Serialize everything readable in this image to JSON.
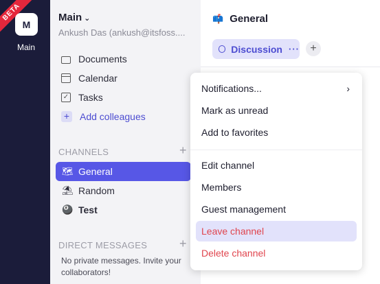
{
  "rail": {
    "badge": "BETA",
    "workspace_initial": "M",
    "workspace_label": "Main"
  },
  "sidebar": {
    "workspace_name": "Main",
    "workspace_user": "Ankush Das (ankush@itsfoss....",
    "nav": [
      {
        "label": "Documents",
        "icon": "folder-icon"
      },
      {
        "label": "Calendar",
        "icon": "calendar-icon"
      },
      {
        "label": "Tasks",
        "icon": "checkbox-icon"
      },
      {
        "label": "Add colleagues",
        "icon": "plus-icon"
      }
    ],
    "channels_header": "CHANNELS",
    "channels": [
      {
        "emoji": "🗺",
        "label": "General"
      },
      {
        "emoji": "⛱",
        "label": "Random"
      },
      {
        "emoji": "🎱",
        "label": "Test"
      }
    ],
    "dm_header": "DIRECT MESSAGES",
    "dm_empty": "No private messages. Invite your collaborators!"
  },
  "main": {
    "channel_emoji": "📫",
    "channel_title": "General",
    "tab_label": "Discussion",
    "tab_more": "···",
    "tab_add": "+"
  },
  "menu": {
    "items": [
      "Notifications...",
      "Mark as unread",
      "Add to favorites",
      "Edit channel",
      "Members",
      "Guest management",
      "Leave channel",
      "Delete channel"
    ],
    "submenu_arrow": "›"
  },
  "colors": {
    "rail": "#1b1c3a",
    "accent": "#5757e6",
    "danger": "#e0454e",
    "badge": "#e5273c"
  }
}
